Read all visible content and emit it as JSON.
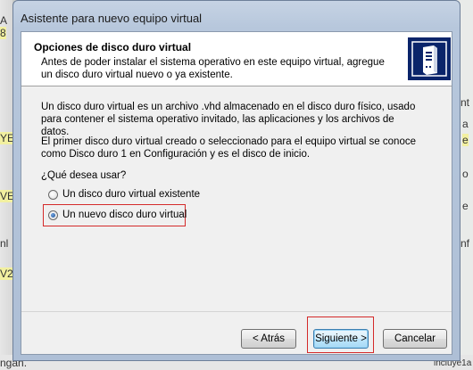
{
  "background": {
    "left_fragments": [
      "A",
      "8",
      "YE",
      "VE",
      "V2",
      "nl",
      "ngan."
    ],
    "right_fragments": [
      "nt",
      "a",
      "e",
      "o",
      "e",
      "nf",
      "lnciuye1a"
    ]
  },
  "window": {
    "title": "Asistente para nuevo equipo virtual"
  },
  "header": {
    "title": "Opciones de disco duro virtual",
    "description": "Antes de poder instalar el sistema operativo en este equipo virtual, agregue un disco duro virtual nuevo o ya existente.",
    "icon": "server-tower-icon"
  },
  "content": {
    "para1": "Un disco duro virtual es un archivo .vhd almacenado en el disco duro físico, usado para contener el sistema operativo invitado, las aplicaciones y los archivos de datos.",
    "para2": "El primer disco duro virtual creado o seleccionado para el equipo virtual se conoce como Disco duro 1 en Configuración y es el disco de inicio.",
    "question": "¿Qué desea usar?",
    "options": [
      {
        "label": "Un disco duro virtual existente",
        "selected": false
      },
      {
        "label": "Un nuevo disco duro virtual",
        "selected": true
      }
    ]
  },
  "footer": {
    "back_label": "< Atrás",
    "next_label": "Siguiente >",
    "cancel_label": "Cancelar"
  },
  "colors": {
    "annotation": "#d42a2a",
    "accent": "#0a246a"
  }
}
